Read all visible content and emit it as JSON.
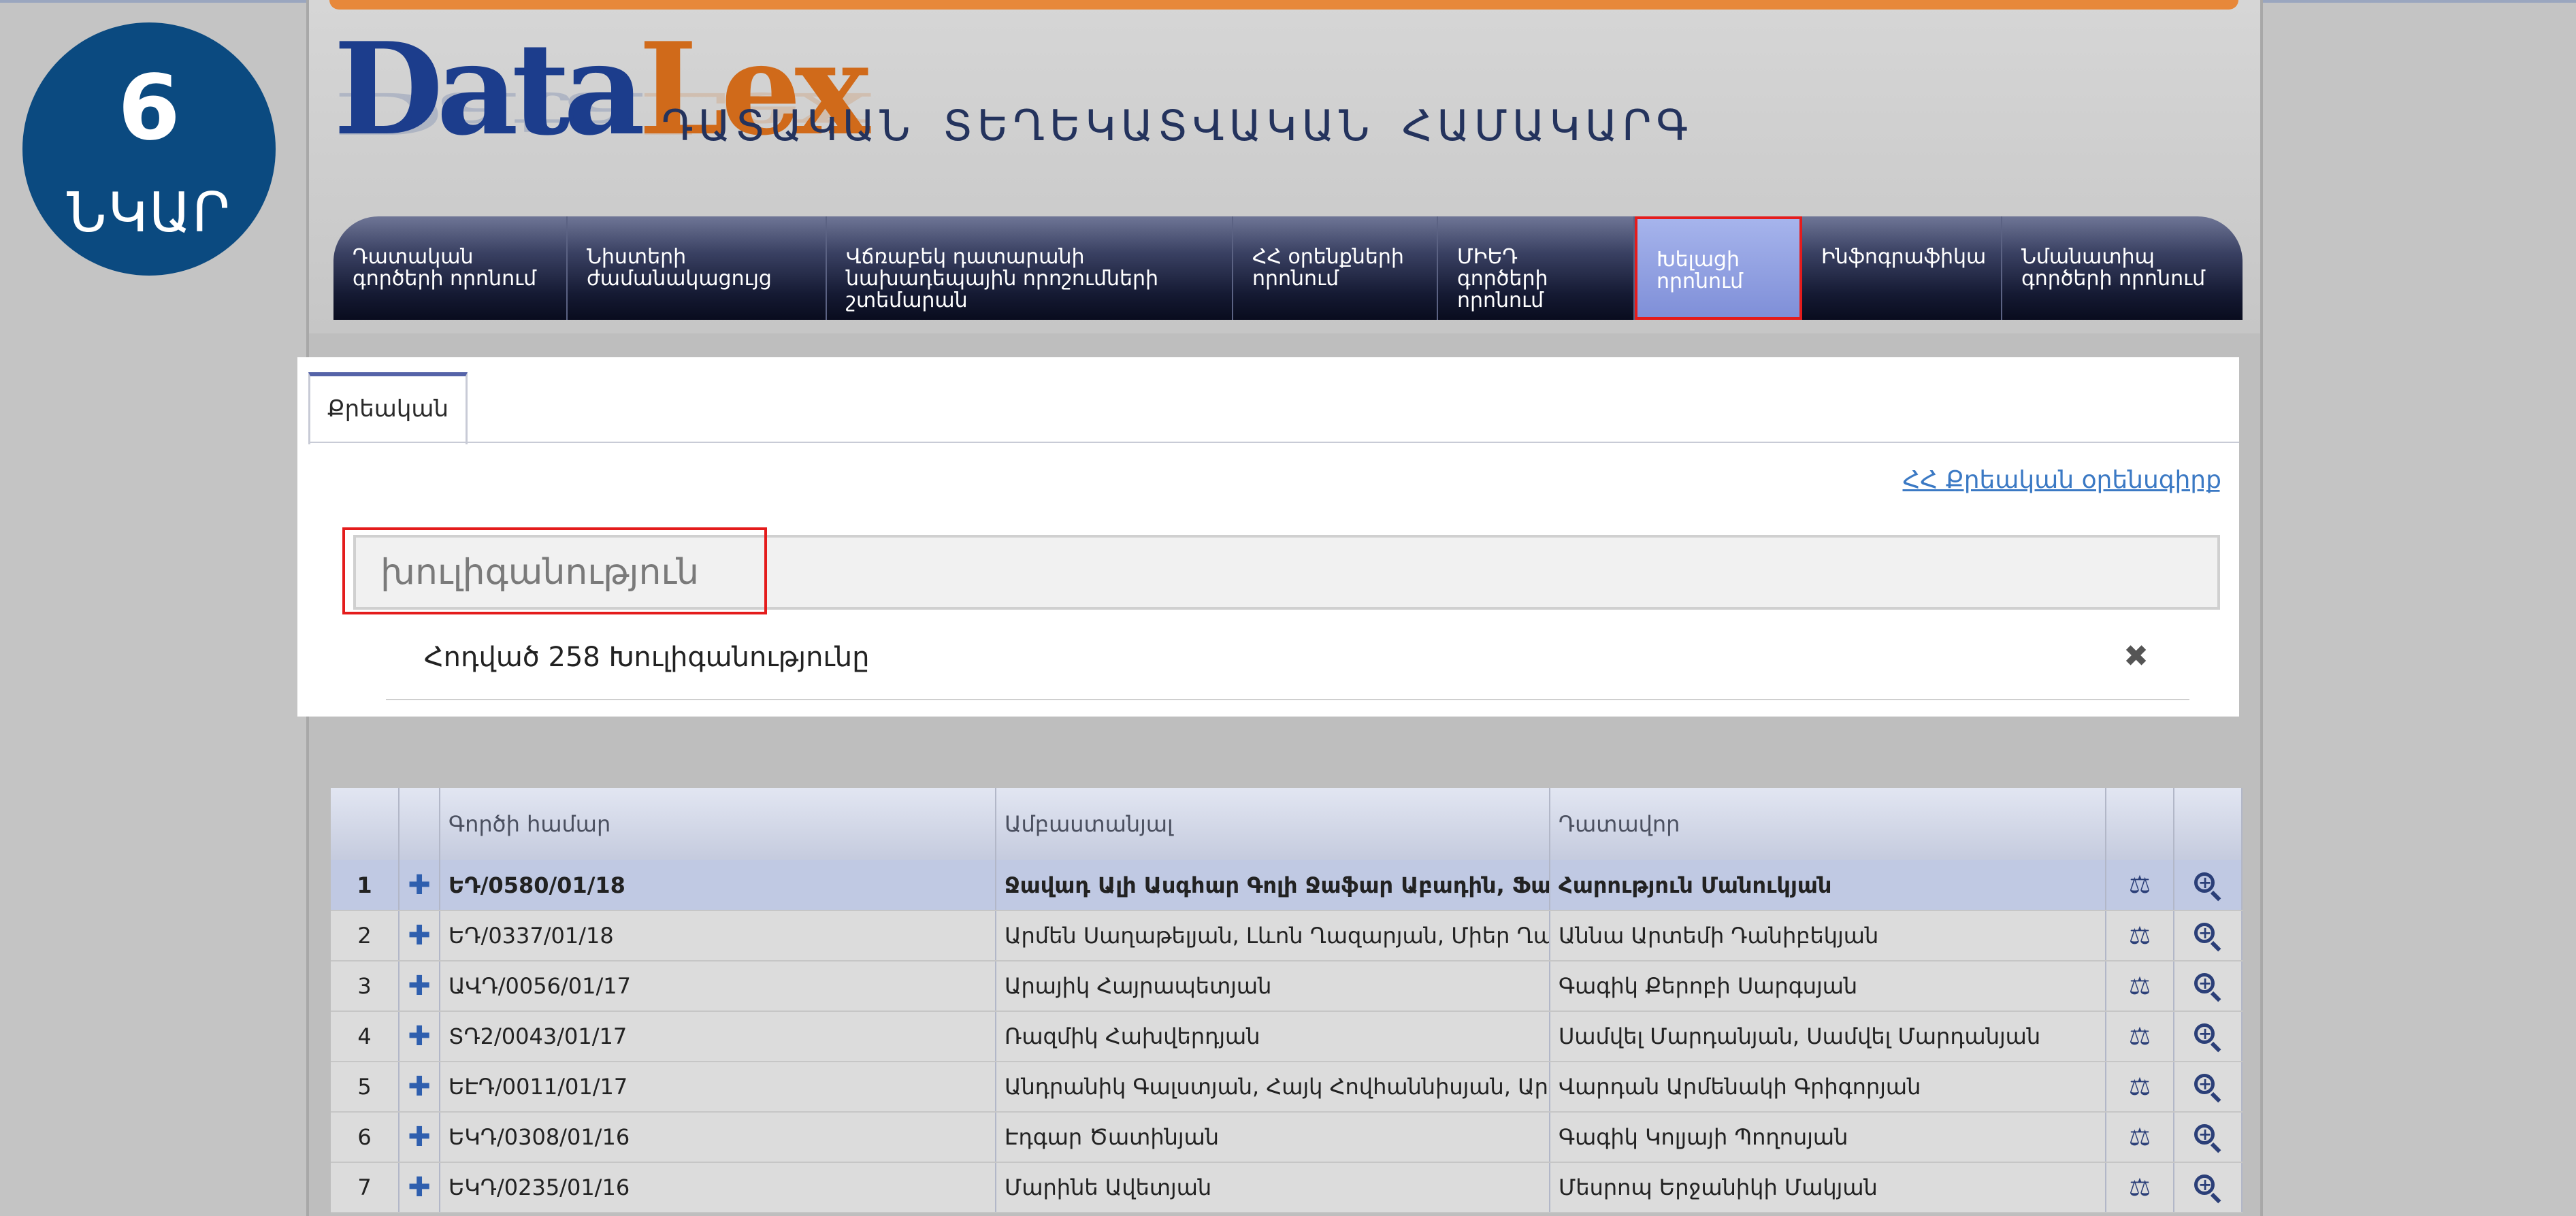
{
  "badge": {
    "number": "6",
    "word": "ՆԿԱՐ"
  },
  "header": {
    "logo_part1": "Data",
    "logo_part2": "Lex",
    "site_title": "ԴԱՏԱԿԱՆ ՏԵՂԵԿԱՏՎԱԿԱՆ ՀԱՄԱԿԱՐԳ"
  },
  "nav": {
    "items": [
      {
        "line1": "Դատական",
        "line2": "գործերի որոնում",
        "line3": ""
      },
      {
        "line1": "Նիստերի",
        "line2": "ժամանակացույց",
        "line3": ""
      },
      {
        "line1": "Վճռաբեկ դատարանի",
        "line2": "նախադեպային որոշումների",
        "line3": "շտեմարան"
      },
      {
        "line1": "ՀՀ օրենքների",
        "line2": "որոնում",
        "line3": ""
      },
      {
        "line1": "ՄԻԵԴ",
        "line2": "գործերի",
        "line3": "որոնում"
      },
      {
        "line1": "Խելացի",
        "line2": "որոնում",
        "line3": ""
      },
      {
        "line1": "Ինֆոգրաֆիկա",
        "line2": "",
        "line3": ""
      },
      {
        "line1": "Նմանատիպ",
        "line2": "գործերի որոնում",
        "line3": ""
      }
    ]
  },
  "panel": {
    "tab_label": "Քրեական",
    "code_link": "ՀՀ Քրեական օրենսգիրք",
    "search_value": "խուլիգանություն",
    "result_item": "Հոդված 258 Խուլիգանությունը",
    "close_symbol": "✖"
  },
  "table": {
    "headers": [
      "",
      "",
      "Գործի համար",
      "Ամբաստանյալ",
      "Դատավոր",
      "",
      ""
    ],
    "rows": [
      {
        "n": "1",
        "case": "ԵԴ/0580/01/18",
        "defendant": "Ջավադ Ալի Ասգհար Գոլի Ջաֆար Աբադին, Ֆարշիդ",
        "judge": "Հարություն Մանուկյան"
      },
      {
        "n": "2",
        "case": "ԵԴ/0337/01/18",
        "defendant": "Արմեն Սաղաթելյան, Լևոն Ղազարյան, Միեր Ղազարյան",
        "judge": "Աննա Արտեմի Դանիբեկյան"
      },
      {
        "n": "3",
        "case": "ԱՎԴ/0056/01/17",
        "defendant": "Արայիկ Հայրապետյան",
        "judge": "Գագիկ Քերոբի Սարգսյան"
      },
      {
        "n": "4",
        "case": "ՏԴ2/0043/01/17",
        "defendant": "Ռազմիկ Հախվերդյան",
        "judge": "Սամվել Մարդանյան, Սամվել Մարդանյան"
      },
      {
        "n": "5",
        "case": "ԵԷԴ/0011/01/17",
        "defendant": "Անդրանիկ Գալստյան, Հայկ Հովհաննիսյան, Արմեն Հ",
        "judge": "Վարդան Արմենակի Գրիգորյան"
      },
      {
        "n": "6",
        "case": "ԵԿԴ/0308/01/16",
        "defendant": "Էդգար Ծատինյան",
        "judge": "Գագիկ Կոլյայի Պողոսյան"
      },
      {
        "n": "7",
        "case": "ԵԿԴ/0235/01/16",
        "defendant": "Մարինե Ավետյան",
        "judge": "Մեսրոպ Երջանիկի Մակյան"
      }
    ]
  },
  "icons": {
    "expand": "plus-icon",
    "scales": "scales-icon",
    "zoom": "magnifier-icon"
  },
  "colors": {
    "badge": "#0b4a80",
    "nav_dark": "#0f132a",
    "nav_active": "#8b9be0",
    "highlight": "#e41c1c",
    "link": "#3b79c4"
  }
}
